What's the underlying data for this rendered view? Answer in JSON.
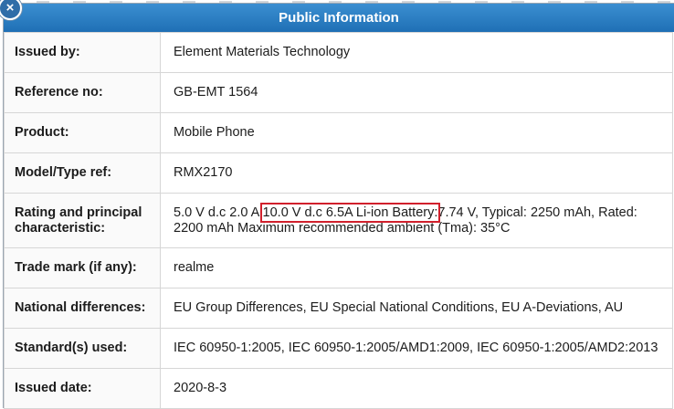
{
  "header": {
    "title": "Public Information",
    "close_icon": "close-icon"
  },
  "rows": [
    {
      "label": "Issued by:",
      "value": "Element Materials Technology"
    },
    {
      "label": "Reference no:",
      "value": "GB-EMT 1564"
    },
    {
      "label": "Product:",
      "value": "Mobile Phone"
    },
    {
      "label": "Model/Type ref:",
      "value": "RMX2170"
    },
    {
      "label": "Rating and principal characteristic:",
      "value_before": "5.0 V d.c 2.0 A",
      "value_highlight": "10.0 V d.c 6.5A Li-ion Battery:",
      "value_after": "7.74 V, Typical: 2250 mAh, Rated: 2200 mAh Maximum recommended ambient (Tma): 35°C"
    },
    {
      "label": "Trade mark (if any):",
      "value": "realme"
    },
    {
      "label": "National differences:",
      "value": "EU Group Differences, EU Special National Conditions, EU A-Deviations, AU"
    },
    {
      "label": "Standard(s) used:",
      "value": "IEC 60950-1:2005, IEC 60950-1:2005/AMD1:2009, IEC 60950-1:2005/AMD2:2013"
    },
    {
      "label": "Issued date:",
      "value": "2020-8-3"
    }
  ],
  "colors": {
    "header": "#2a7cc4",
    "highlight_border": "#d1202c"
  }
}
